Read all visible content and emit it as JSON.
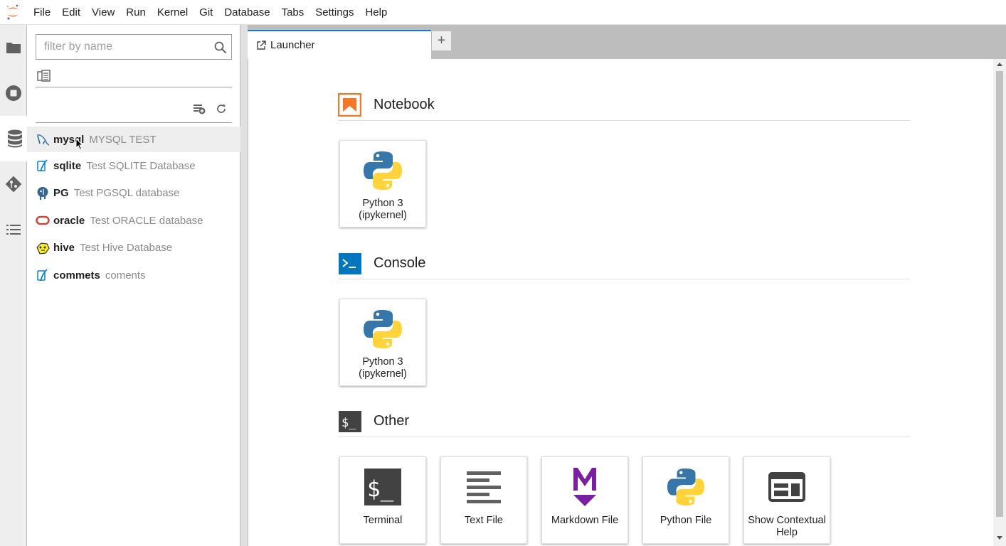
{
  "menubar": {
    "logo": "jupyter-logo-icon",
    "items": [
      "File",
      "Edit",
      "View",
      "Run",
      "Kernel",
      "Git",
      "Database",
      "Tabs",
      "Settings",
      "Help"
    ]
  },
  "activitybar": {
    "tabs": [
      "folder-icon",
      "stop-circle-icon",
      "database-icon",
      "git-icon",
      "list-icon"
    ],
    "active": "database-icon"
  },
  "sidepanel": {
    "filter_placeholder": "filter by name",
    "connections": [
      {
        "name": "mysql",
        "description": "MYSQL TEST",
        "icon": "mysql-icon",
        "selected": true
      },
      {
        "name": "sqlite",
        "description": "Test SQLITE Database",
        "icon": "sqlite-icon"
      },
      {
        "name": "PG",
        "description": "Test PGSQL database",
        "icon": "postgresql-icon"
      },
      {
        "name": "oracle",
        "description": "Test ORACLE database",
        "icon": "oracle-icon"
      },
      {
        "name": "hive",
        "description": "Test Hive Database",
        "icon": "hive-icon"
      },
      {
        "name": "commets",
        "description": "coments",
        "icon": "sqlite-icon"
      }
    ]
  },
  "tabs": {
    "launcher_label": "Launcher",
    "add_label": "+"
  },
  "launcher": {
    "sections": {
      "notebook": {
        "title": "Notebook",
        "cards": [
          "Python 3\n(ipykernel)"
        ]
      },
      "console": {
        "title": "Console",
        "cards": [
          "Python 3\n(ipykernel)"
        ]
      },
      "other": {
        "title": "Other",
        "cards": [
          "Terminal",
          "Text File",
          "Markdown File",
          "Python File",
          "Show Contextual Help"
        ]
      }
    },
    "notebook_card": {
      "line1": "Python 3",
      "line2": "(ipykernel)"
    },
    "console_card": {
      "line1": "Python 3",
      "line2": "(ipykernel)"
    },
    "other_cards": {
      "terminal": "Terminal",
      "text_file": "Text File",
      "markdown_file": "Markdown File",
      "python_file": "Python File",
      "contextual_help": "Show Contextual Help"
    }
  },
  "colors": {
    "accent": "#1976d2",
    "notebook_orange": "#f37726",
    "console_blue": "#0277bd",
    "markdown_purple": "#7b1fa2"
  }
}
